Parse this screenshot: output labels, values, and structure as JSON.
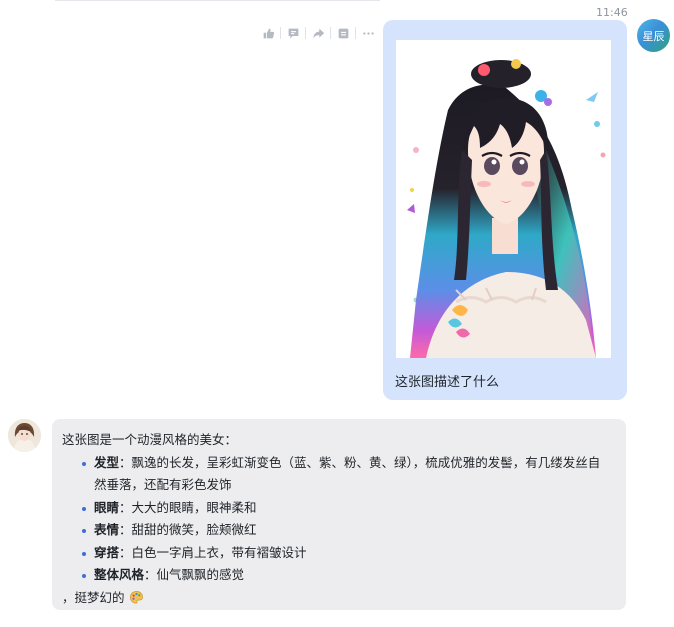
{
  "header": {
    "time": "11:46"
  },
  "user": {
    "avatar_label": "星辰",
    "message_text": "这张图描述了什么",
    "image_alt": "动漫风格的美女插画"
  },
  "bot": {
    "intro": "这张图是一个动漫风格的美女：",
    "items": [
      {
        "label": "发型",
        "sep": "：",
        "text": "飘逸的长发，呈彩虹渐变色（蓝、紫、粉、黄、绿），梳成优雅的发髻，有几缕发丝自然垂落，还配有彩色发饰"
      },
      {
        "label": "眼睛",
        "sep": "：",
        "text": "大大的眼睛，眼神柔和"
      },
      {
        "label": "表情",
        "sep": "：",
        "text": "甜甜的微笑，脸颊微红"
      },
      {
        "label": "穿搭",
        "sep": "：",
        "text": "白色一字肩上衣，带有褶皱设计"
      },
      {
        "label": "整体风格",
        "sep": "：",
        "text": "仙气飘飘的感觉"
      }
    ],
    "outro": "，挺梦幻的"
  },
  "actions": [
    "thumbs-up-icon",
    "comment-icon",
    "share-icon",
    "copy-icon",
    "more-icon"
  ],
  "colors": {
    "user_bubble": "#d5e4fc",
    "bot_bubble": "#ededef",
    "bullet": "#3a6fd8"
  }
}
